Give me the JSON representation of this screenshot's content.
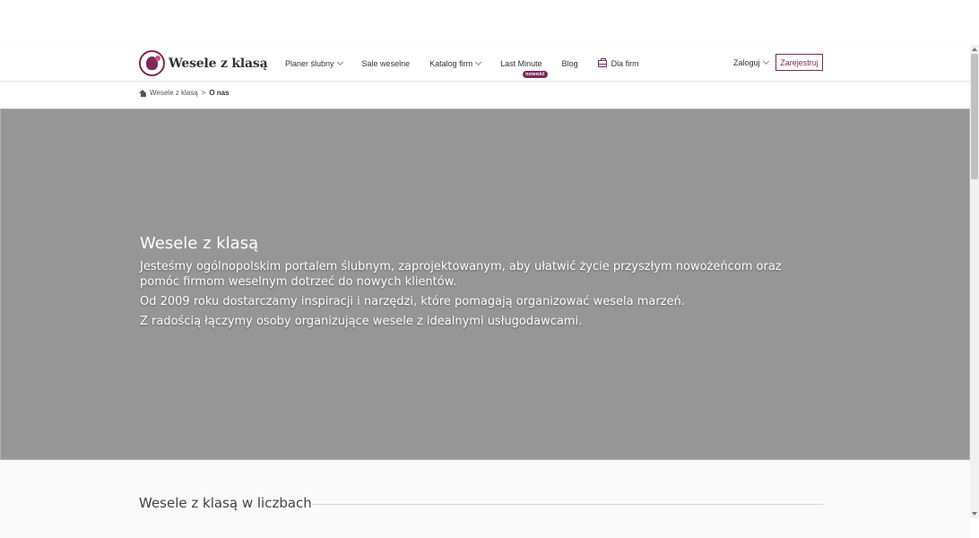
{
  "header": {
    "logo_text": "Wesele z klasą",
    "nav": [
      {
        "label": "Planer ślubny",
        "dropdown": true
      },
      {
        "label": "Sale weselne",
        "dropdown": false
      },
      {
        "label": "Katalog firm",
        "dropdown": true
      },
      {
        "label": "Last Minute",
        "badge": "nowość"
      },
      {
        "label": "Blog"
      },
      {
        "label": "Dla firm",
        "icon": "briefcase-icon"
      }
    ],
    "login_label": "Zaloguj",
    "register_label": "Zarejestruj"
  },
  "breadcrumb": {
    "home": "Wesele z klasą",
    "separator": ">",
    "current": "O nas"
  },
  "hero": {
    "title": "Wesele z klasą",
    "paragraphs": [
      "Jesteśmy ogólnopolskim portalem ślubnym, zaprojektowanym, aby ułatwić życie przyszłym nowożeńcom oraz pomóc firmom weselnym dotrzeć do nowych klientów.",
      "Od 2009 roku dostarczamy inspiracji i narzędzi, które pomagają organizować wesela marzeń.",
      "Z radością łączymy osoby organizujące wesele z idealnymi usługodawcami."
    ]
  },
  "stats": {
    "title": "Wesele z klasą w liczbach"
  },
  "colors": {
    "brand": "#7b2a59",
    "text": "#333333"
  }
}
